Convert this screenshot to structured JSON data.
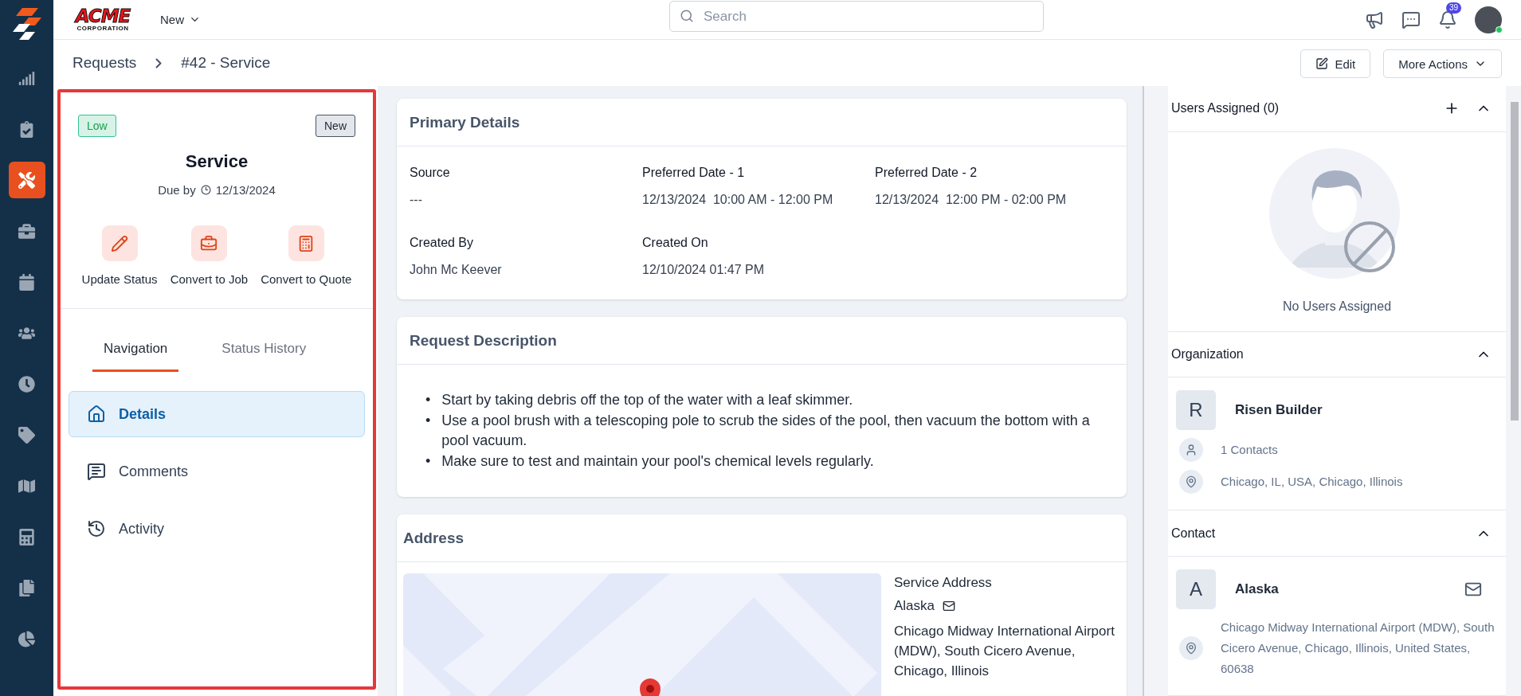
{
  "sidebar": {
    "items": [
      {
        "selected": false
      },
      {
        "selected": false
      },
      {
        "selected": true
      },
      {
        "selected": false
      },
      {
        "selected": false
      },
      {
        "selected": false
      },
      {
        "selected": false
      },
      {
        "selected": false
      },
      {
        "selected": false
      },
      {
        "selected": false
      },
      {
        "selected": false
      },
      {
        "selected": false
      }
    ]
  },
  "topbar": {
    "logo": {
      "name": "ACME",
      "subtitle": "CORPORATION"
    },
    "menu": "New",
    "search": {
      "placeholder": "Search"
    },
    "notifications_badge": "39",
    "user": {
      "online": true
    }
  },
  "breadcrumb": [
    "Requests",
    "#42 - Service"
  ],
  "page_actions": [
    {
      "kind": "edit",
      "label": "Edit"
    },
    {
      "kind": "menu",
      "label": "More Actions"
    }
  ],
  "summary": {
    "priority": "Low",
    "status": "New",
    "title": "Service",
    "due_label": "Due by",
    "due_date": "12/13/2024",
    "actions": [
      {
        "kind": "status",
        "label": "Update Status"
      },
      {
        "kind": "job",
        "label": "Convert to Job"
      },
      {
        "kind": "quote",
        "label": "Convert to Quote"
      }
    ],
    "tabs": [
      {
        "label": "Navigation",
        "selected": true
      },
      {
        "label": "Status History",
        "selected": false
      }
    ],
    "nav": [
      {
        "kind": "details",
        "label": "Details",
        "selected": true
      },
      {
        "kind": "comments",
        "label": "Comments",
        "selected": false
      },
      {
        "kind": "activity",
        "label": "Activity",
        "selected": false
      }
    ]
  },
  "primary_details": {
    "title": "Primary Details",
    "fields": [
      {
        "label": "Source",
        "value": "---"
      },
      {
        "label": "Preferred Date - 1",
        "value": "12/13/2024  10:00 AM - 12:00 PM"
      },
      {
        "label": "Preferred Date - 2",
        "value": "12/13/2024  12:00 PM - 02:00 PM"
      },
      {
        "label": "Created By",
        "value": "John Mc Keever"
      },
      {
        "label": "Created On",
        "value": "12/10/2024 01:47 PM"
      }
    ]
  },
  "request_description": {
    "title": "Request Description",
    "items": [
      {
        "marker": "•",
        "text": "Start by taking debris off the top of the water with a leaf skimmer."
      },
      {
        "marker": "•",
        "text": "Use a pool brush with a telescoping pole to scrub the sides of the pool, then vacuum the bottom with a pool vacuum."
      },
      {
        "marker": "•",
        "text": "Make sure to test and maintain your pool's chemical levels regularly."
      }
    ]
  },
  "address": {
    "title": "Address",
    "label": "Service Address",
    "contact": "Alaska",
    "text": "Chicago Midway International Airport (MDW), South Cicero Avenue, Chicago, Illinois"
  },
  "users_assigned": {
    "title": "Users Assigned (0)",
    "expanded": true,
    "empty_text": "No Users Assigned"
  },
  "organization": {
    "title": "Organization",
    "expanded": true,
    "initial": "R",
    "name": "Risen Builder",
    "contacts": "1 Contacts",
    "location": "Chicago, IL, USA, Chicago, Illinois"
  },
  "contact": {
    "title": "Contact",
    "expanded": true,
    "initial": "A",
    "name": "Alaska",
    "address": "Chicago Midway International Airport (MDW), South Cicero Avenue, Chicago, Illinois, United States, 60638"
  }
}
